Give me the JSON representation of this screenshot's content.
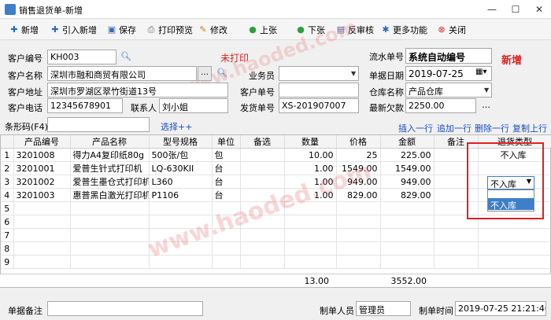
{
  "window": {
    "title": "销售退货单-新增"
  },
  "toolbar": {
    "new": "新增",
    "import_new": "引入新增",
    "save": "保存",
    "print_preview": "打印预览",
    "edit": "修改",
    "prev": "上张",
    "next": "下张",
    "unaudit": "反审核",
    "more": "更多功能",
    "close": "关闭"
  },
  "form": {
    "customer_code_label": "客户编号",
    "customer_code": "KH003",
    "print_status": "未打印",
    "serial_label": "流水单号",
    "serial_value": "系统自动编号",
    "mode_badge": "新增",
    "customer_name_label": "客户名称",
    "customer_name": "深圳市融和商贸有限公司",
    "salesman_label": "业务员",
    "salesman": "",
    "date_label": "单据日期",
    "date": "2019-07-25",
    "address_label": "客户地址",
    "address": "深圳市罗湖区翠竹街道13号",
    "customer_order_label": "客户单号",
    "customer_order": "",
    "warehouse_label": "仓库名称",
    "warehouse": "产品仓库",
    "phone_label": "客户电话",
    "phone": "12345678901",
    "contact_label": "联系人",
    "contact": "刘小姐",
    "ship_no_label": "发货单号",
    "ship_no": "XS-201907007",
    "debt_label": "最新欠款",
    "debt": "2250.00"
  },
  "barcode": {
    "label": "条形码(F4)",
    "value": "",
    "select_more": "选择++"
  },
  "row_actions": {
    "insert": "插入一行",
    "append": "追加一行",
    "delete": "删除一行",
    "copy": "复制上行"
  },
  "table": {
    "headers": [
      "",
      "产品编号",
      "产品名称",
      "型号规格",
      "单位",
      "备选",
      "数量",
      "价格",
      "金额",
      "备注",
      "退货类型"
    ],
    "rows": [
      {
        "n": "1",
        "code": "3201008",
        "name": "得力A4复印纸80g",
        "spec": "500张/包",
        "unit": "包",
        "alt": "",
        "qty": "10.00",
        "price": "25",
        "amount": "225.00",
        "note": "",
        "type": "不入库"
      },
      {
        "n": "2",
        "code": "3201001",
        "name": "爱普生针式打印机",
        "spec": "LQ-630KII",
        "unit": "台",
        "alt": "",
        "qty": "1.00",
        "price": "1549.00",
        "amount": "1549.00",
        "note": "",
        "type": ""
      },
      {
        "n": "3",
        "code": "3201002",
        "name": "爱普生墨仓式打印机",
        "spec": "L360",
        "unit": "台",
        "alt": "",
        "qty": "1.00",
        "price": "949.00",
        "amount": "949.00",
        "note": "",
        "type": "不入库"
      },
      {
        "n": "4",
        "code": "3201003",
        "name": "惠普黑白激光打印机",
        "spec": "P1106",
        "unit": "台",
        "alt": "",
        "qty": "1.00",
        "price": "829.00",
        "amount": "829.00",
        "note": "",
        "type": ""
      },
      {
        "n": "5"
      },
      {
        "n": "6"
      },
      {
        "n": "7"
      },
      {
        "n": "8"
      },
      {
        "n": "9"
      }
    ],
    "dropdown_option": "不入库",
    "total_qty": "13.00",
    "total_amount": "3552.00"
  },
  "footer": {
    "remark_label": "单据备注",
    "remark": "",
    "maker_label": "制单人员",
    "maker": "管理员",
    "time_label": "制单时间",
    "time": "2019-07-25 21:21:46"
  },
  "watermark": "www.haoded.com",
  "colors": {
    "accent_red": "#e02020",
    "link_blue": "#1a4fc0",
    "selection_blue": "#3d7fc9"
  }
}
